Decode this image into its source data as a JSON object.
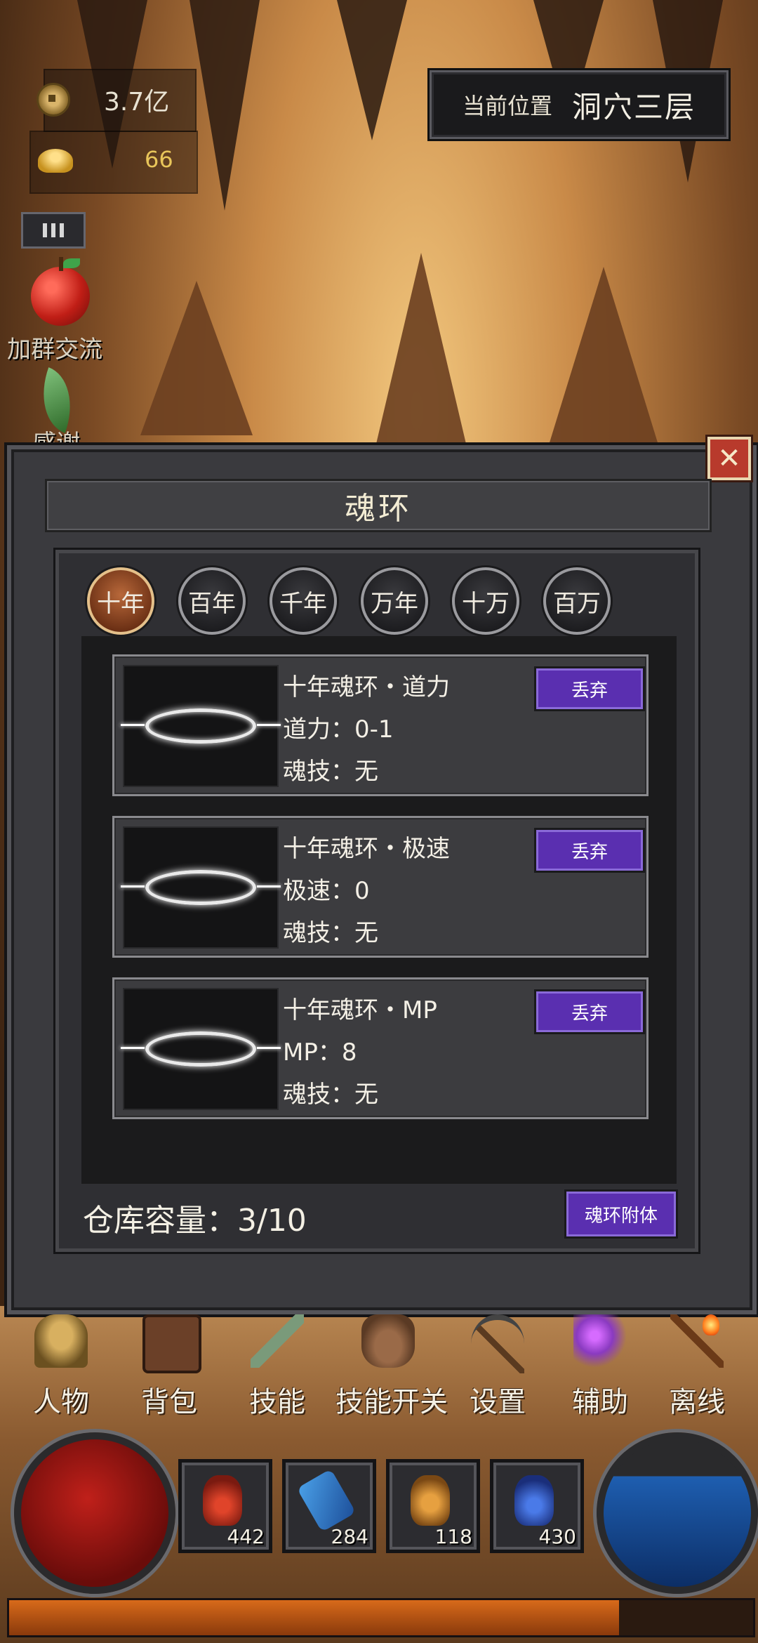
{
  "hud": {
    "copper": "3.7亿",
    "gold": "66",
    "location_label": "当前位置",
    "location_value": "洞穴三层",
    "group_link": "加群交流",
    "thanks_link": "感谢"
  },
  "panel": {
    "title": "魂环",
    "tabs": [
      "十年",
      "百年",
      "千年",
      "万年",
      "十万",
      "百万"
    ],
    "active_tab": "十年",
    "rings": [
      {
        "title": "十年魂环・道力",
        "stat": "道力：0-1",
        "skill": "魂技：无",
        "action": "丢弃"
      },
      {
        "title": "十年魂环・极速",
        "stat": "极速：0",
        "skill": "魂技：无",
        "action": "丢弃"
      },
      {
        "title": "十年魂环・MP",
        "stat": "MP：8",
        "skill": "魂技：无",
        "action": "丢弃"
      }
    ],
    "capacity": "仓库容量：3/10",
    "attach_button": "魂环附体"
  },
  "nav": [
    {
      "label": "人物",
      "icon": "helmet-icon"
    },
    {
      "label": "背包",
      "icon": "chest-icon"
    },
    {
      "label": "技能",
      "icon": "axe-icon"
    },
    {
      "label": "技能开关",
      "icon": "glove-icon"
    },
    {
      "label": "设置",
      "icon": "pickaxe-icon"
    },
    {
      "label": "辅助",
      "icon": "magic-hand-icon"
    },
    {
      "label": "离线",
      "icon": "torch-icon"
    }
  ],
  "quickbar": [
    {
      "count": "442",
      "icon": "red-potion-icon"
    },
    {
      "count": "284",
      "icon": "scroll-icon"
    },
    {
      "count": "118",
      "icon": "gold-flask-icon"
    },
    {
      "count": "430",
      "icon": "blue-potion-icon"
    }
  ],
  "xp_fraction": 0.82,
  "mp_fraction": 0.75,
  "colors": {
    "accent_button": "#5a2fb0",
    "active_tab": "#b8683a",
    "close": "#b83a2c"
  }
}
